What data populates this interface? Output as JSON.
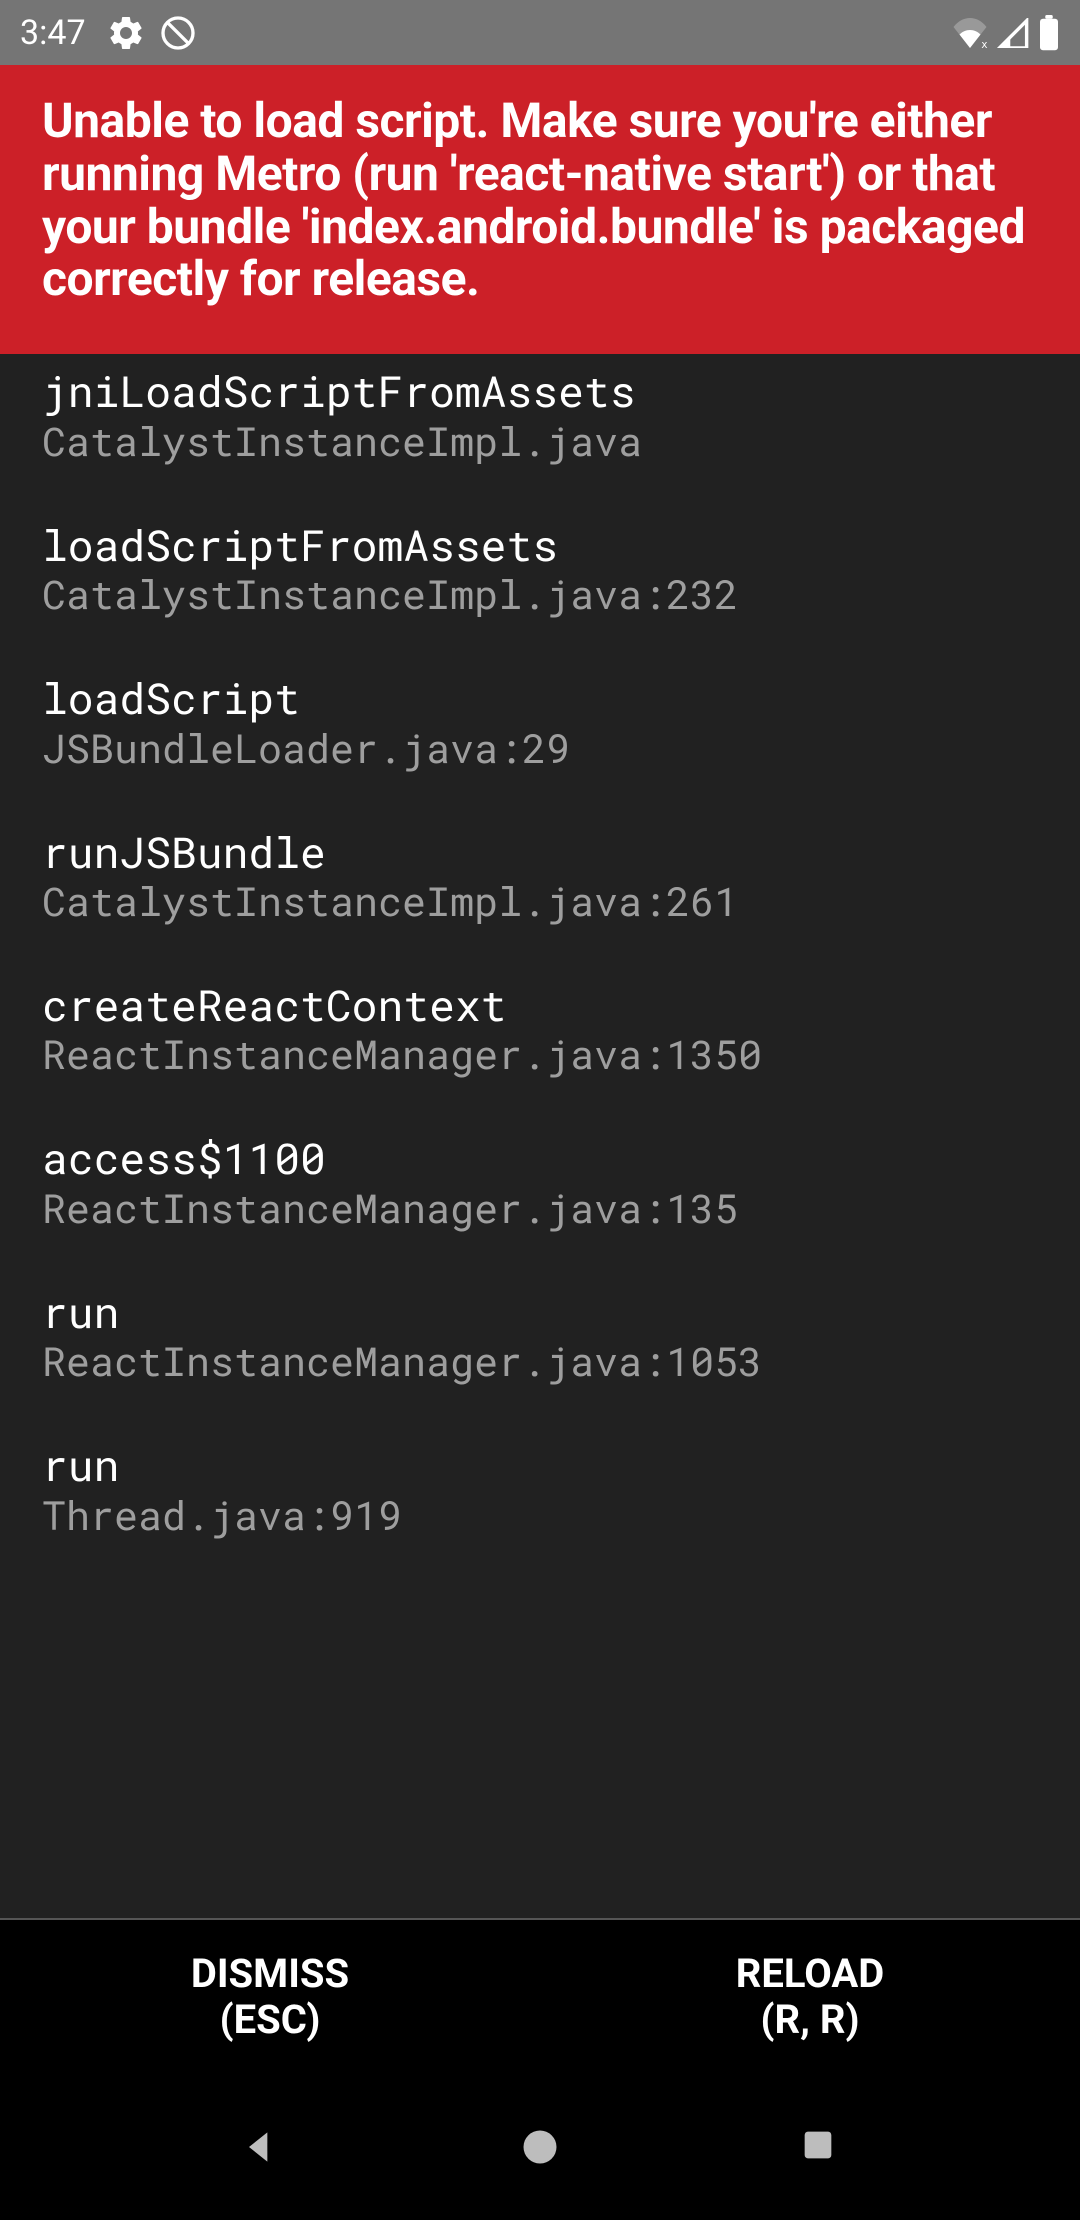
{
  "statusBar": {
    "time": "3:47"
  },
  "error": {
    "message": "Unable to load script. Make sure you're either running Metro (run 'react-native start') or that your bundle 'index.android.bundle' is packaged correctly for release."
  },
  "stackFrames": [
    {
      "method": "jniLoadScriptFromAssets",
      "location": "CatalystInstanceImpl.java"
    },
    {
      "method": "loadScriptFromAssets",
      "location": "CatalystInstanceImpl.java:232"
    },
    {
      "method": "loadScript",
      "location": "JSBundleLoader.java:29"
    },
    {
      "method": "runJSBundle",
      "location": "CatalystInstanceImpl.java:261"
    },
    {
      "method": "createReactContext",
      "location": "ReactInstanceManager.java:1350"
    },
    {
      "method": "access$1100",
      "location": "ReactInstanceManager.java:135"
    },
    {
      "method": "run",
      "location": "ReactInstanceManager.java:1053"
    },
    {
      "method": "run",
      "location": "Thread.java:919"
    }
  ],
  "buttons": {
    "dismiss": {
      "label": "DISMISS",
      "shortcut": "(ESC)"
    },
    "reload": {
      "label": "RELOAD",
      "shortcut": "(R, R)"
    }
  }
}
